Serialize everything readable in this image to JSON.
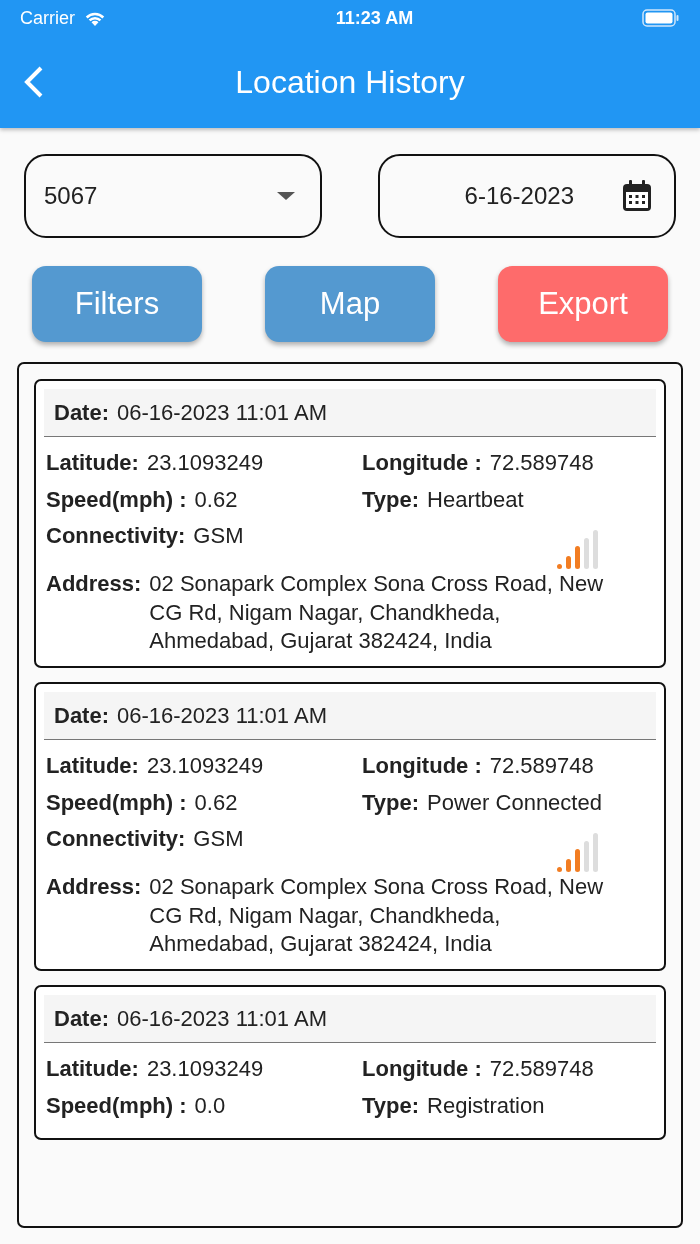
{
  "status_bar": {
    "carrier": "Carrier",
    "time": "11:23 AM"
  },
  "app_bar": {
    "title": "Location History"
  },
  "device_select": {
    "value": "5067"
  },
  "date_field": {
    "value": "6-16-2023"
  },
  "buttons": [
    {
      "label": "Filters",
      "kind": "primary"
    },
    {
      "label": "Map",
      "kind": "primary"
    },
    {
      "label": "Export",
      "kind": "danger"
    }
  ],
  "records": [
    {
      "date_label": "Date:",
      "date": "06-16-2023 11:01 AM",
      "fields": [
        {
          "label": "Latitude:",
          "value": "23.1093249"
        },
        {
          "label": "Longitude :",
          "value": "72.589748"
        },
        {
          "label": "Speed(mph) :",
          "value": "0.62"
        },
        {
          "label": "Type:",
          "value": "Heartbeat"
        }
      ],
      "connectivity": {
        "label": "Connectivity:",
        "value": "GSM"
      },
      "address": {
        "label": "Address:",
        "value": "02 Sonapark Complex Sona Cross Road, New CG Rd, Nigam Nagar, Chandkheda, Ahmedabad, Gujarat 382424, India"
      }
    },
    {
      "date_label": "Date:",
      "date": "06-16-2023 11:01 AM",
      "fields": [
        {
          "label": "Latitude:",
          "value": "23.1093249"
        },
        {
          "label": "Longitude :",
          "value": "72.589748"
        },
        {
          "label": "Speed(mph) :",
          "value": "0.62"
        },
        {
          "label": "Type:",
          "value": "Power Connected"
        }
      ],
      "connectivity": {
        "label": "Connectivity:",
        "value": "GSM"
      },
      "address": {
        "label": "Address:",
        "value": "02 Sonapark Complex Sona Cross Road, New CG Rd, Nigam Nagar, Chandkheda, Ahmedabad, Gujarat 382424, India"
      }
    },
    {
      "date_label": "Date:",
      "date": "06-16-2023 11:01 AM",
      "fields": [
        {
          "label": "Latitude:",
          "value": "23.1093249"
        },
        {
          "label": "Longitude :",
          "value": "72.589748"
        },
        {
          "label": "Speed(mph) :",
          "value": "0.0"
        },
        {
          "label": "Type:",
          "value": "Registration"
        }
      ]
    }
  ]
}
